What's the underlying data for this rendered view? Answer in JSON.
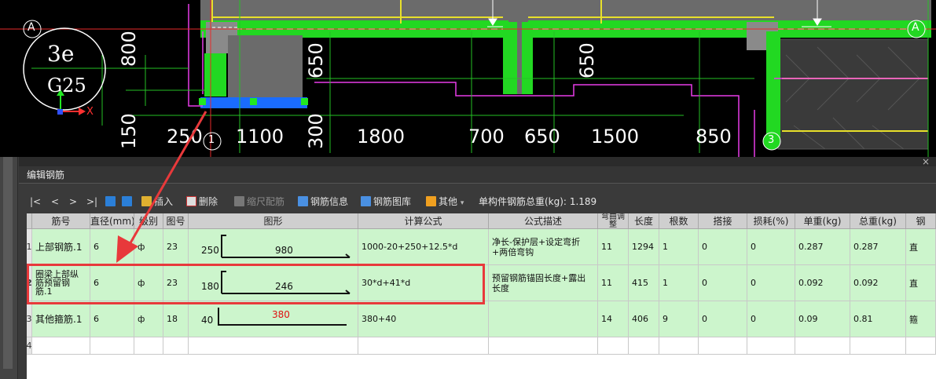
{
  "cad": {
    "axis_a_left": "A",
    "axis_a_right": "A",
    "axis_1": "1",
    "axis_3": "3",
    "section_text_top": "3e",
    "section_text_bottom": "G25",
    "coord_x": "X",
    "dims_vertical": [
      "800",
      "150",
      "650",
      "650"
    ],
    "dims_horizontal": [
      "250",
      "1100",
      "300",
      "1800",
      "700",
      "650",
      "1500",
      "850"
    ]
  },
  "panel": {
    "title": "编辑钢筋",
    "close": "×"
  },
  "toolbar": {
    "first": "|<",
    "prev": "<",
    "next": ">",
    "last": ">|",
    "insert": "插入",
    "delete": "删除",
    "scale": "缩尺配筋",
    "info": "钢筋信息",
    "library": "钢筋图库",
    "other": "其他",
    "total_label": "单构件钢筋总重(kg):",
    "total_value": "1.189"
  },
  "table": {
    "columns": [
      "筋号",
      "直径(mm)",
      "级别",
      "图号",
      "图形",
      "计算公式",
      "公式描述",
      "弯曲调整",
      "长度",
      "根数",
      "搭接",
      "损耗(%)",
      "单重(kg)",
      "总重(kg)",
      "钢"
    ],
    "rows": [
      {
        "n": "1",
        "name": "上部钢筋.1",
        "dia": "6",
        "grade": "ф",
        "fig": "23",
        "shape_left": "250",
        "shape_mid": "980",
        "formula": "1000-20+250+12.5*d",
        "desc": "净长-保护层+设定弯折+两倍弯钩",
        "bend": "11",
        "len": "1294",
        "count": "1",
        "lap": "0",
        "loss": "0",
        "unit": "0.287",
        "total": "0.287",
        "type": "直"
      },
      {
        "n": "2",
        "name": "圈梁上部纵筋预留钢筋.1",
        "dia": "6",
        "grade": "ф",
        "fig": "23",
        "shape_left": "180",
        "shape_mid": "246",
        "formula": "30*d+41*d",
        "desc": "预留钢筋锚固长度+露出长度",
        "bend": "11",
        "len": "415",
        "count": "1",
        "lap": "0",
        "loss": "0",
        "unit": "0.092",
        "total": "0.092",
        "type": "直"
      },
      {
        "n": "3",
        "name": "其他箍筋.1",
        "dia": "6",
        "grade": "ф",
        "fig": "18",
        "shape_left": "40",
        "shape_mid": "380",
        "formula": "380+40",
        "desc": "",
        "bend": "14",
        "len": "406",
        "count": "9",
        "lap": "0",
        "loss": "0",
        "unit": "0.09",
        "total": "0.81",
        "type": "箍"
      },
      {
        "n": "4"
      }
    ]
  },
  "colors": {
    "row_green": "#ccf5cc",
    "highlight_red": "#e8393b",
    "shape_value_red": "#e01010"
  }
}
